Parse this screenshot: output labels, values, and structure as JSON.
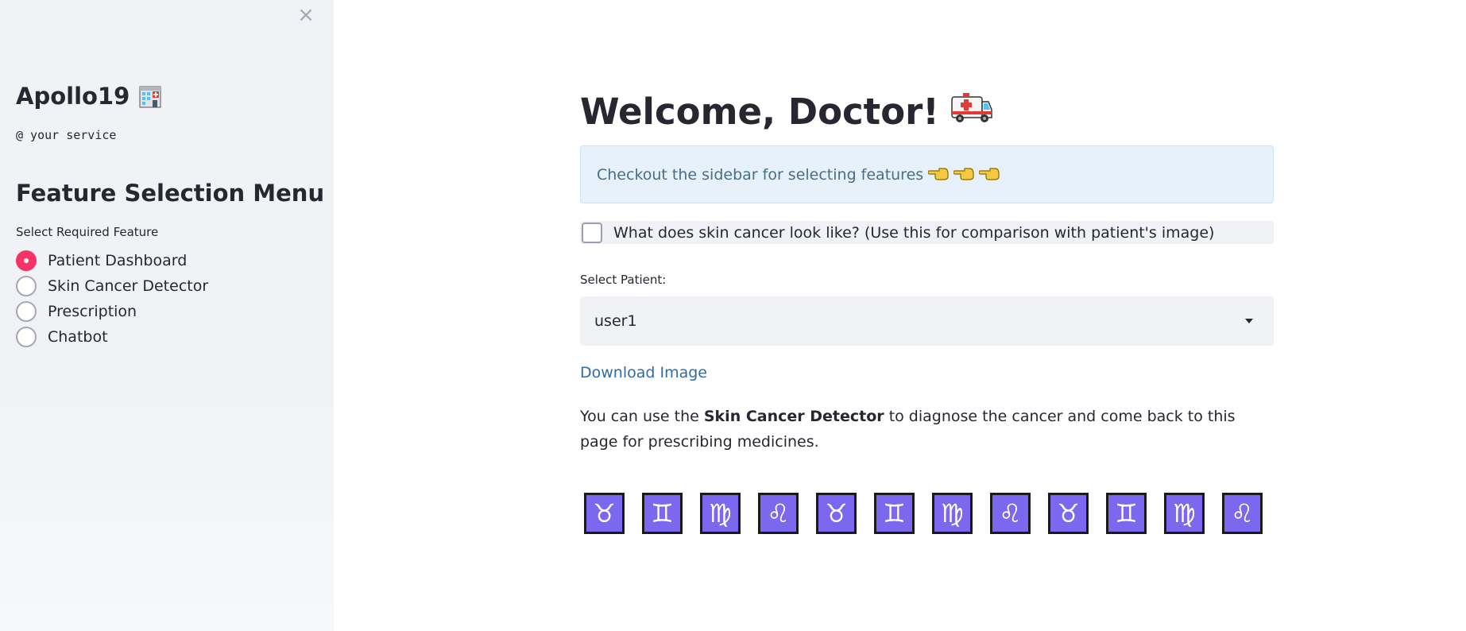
{
  "sidebar": {
    "close_glyph": "×",
    "app_title": "Apollo19",
    "subtitle": "@ your service",
    "menu_title": "Feature Selection Menu",
    "radio_label": "Select Required Feature",
    "options": [
      {
        "label": "Patient Dashboard",
        "selected": true
      },
      {
        "label": "Skin Cancer Detector",
        "selected": false
      },
      {
        "label": "Prescription",
        "selected": false
      },
      {
        "label": "Chatbot",
        "selected": false
      }
    ]
  },
  "main": {
    "welcome": "Welcome, Doctor!",
    "info_text": "Checkout the sidebar for selecting features",
    "checkbox_label": "What does skin cancer look like? (Use this for comparison with patient's image)",
    "select_label": "Select Patient:",
    "select_value": "user1",
    "download_link": "Download Image",
    "para_pre": "You can use the ",
    "para_bold": "Skin Cancer Detector",
    "para_post": " to diagnose the cancer and come back to this page for prescribing medicines.",
    "zodiac": [
      "♉",
      "♊",
      "♍",
      "♌",
      "♉",
      "♊",
      "♍",
      "♌",
      "♉",
      "♊",
      "♍",
      "♌"
    ]
  },
  "colors": {
    "accent": "#f63366",
    "info_bg": "#e6f1f9",
    "link": "#2e6da4",
    "zodiac_bg": "#7b68ee"
  }
}
